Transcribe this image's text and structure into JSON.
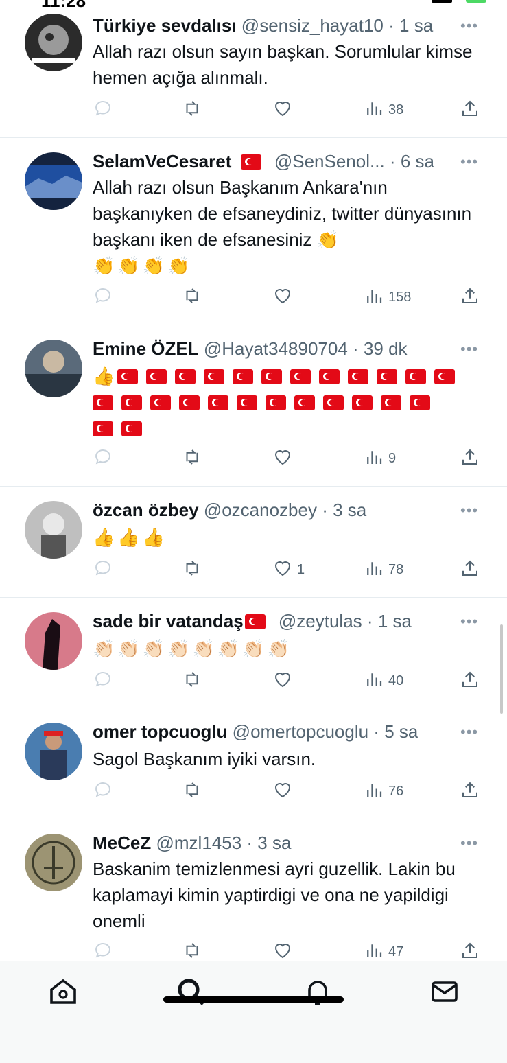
{
  "status_bar": {
    "time": "11:28"
  },
  "tweets": [
    {
      "name": "Türkiye sevdalısı",
      "handle": "@sensiz_hayat10",
      "time": "1 sa",
      "text": "Allah razı olsun sayın başkan. Sorumlular kimse hemen açığa alınmalı.",
      "views": "38",
      "likes": "",
      "avatar_color": "#2b2b2b"
    },
    {
      "name": "SelamVeCesaret",
      "name_flag": "tr-flag",
      "handle": "@SenSenol...",
      "time": "6 sa",
      "text": "Allah razı olsun Başkanım Ankara'nın başkanıyken de efsaneydiniz, twitter dünyasının başkanı iken de efsanesiniz 👏",
      "text2": "👏👏👏👏",
      "views": "158",
      "likes": "",
      "avatar_color": "#1f4fa0"
    },
    {
      "name": "Emine ÖZEL",
      "handle": "@Hayat34890704",
      "time": "39 dk",
      "text": "👍",
      "flag_count": 26,
      "views": "9",
      "likes": "",
      "avatar_color": "#5a6a7a"
    },
    {
      "name": "özcan özbey",
      "handle": "@ozcanozbey",
      "time": "3 sa",
      "text": "👍👍👍",
      "views": "78",
      "likes": "1",
      "avatar_color": "#bfbfbf"
    },
    {
      "name": "sade bir vatandaş",
      "name_flag": "tr-flag",
      "handle": "@zeytulas",
      "time": "1 sa",
      "text": "👏🏻👏🏻👏🏻👏🏻👏🏻👏🏻👏🏻👏🏻",
      "views": "40",
      "likes": "",
      "avatar_color": "#d77a8a"
    },
    {
      "name": "omer topcuoglu",
      "handle": "@omertopcuoglu",
      "time": "5 sa",
      "text": "Sagol Başkanım iyiki varsın.",
      "views": "76",
      "likes": "",
      "avatar_color": "#4a7db0"
    },
    {
      "name": "MeCeZ",
      "handle": "@mzl1453",
      "time": "3 sa",
      "text": "Baskanim temizlenmesi ayri guzellik. Lakin bu kaplamayi kimin yaptirdigi ve ona ne yapildigi onemli",
      "views": "47",
      "likes": "",
      "avatar_color": "#9c9473"
    }
  ],
  "separator": "·",
  "more_label": "•••",
  "tabs": [
    "home-icon",
    "search-icon",
    "notifications-icon",
    "messages-icon"
  ]
}
